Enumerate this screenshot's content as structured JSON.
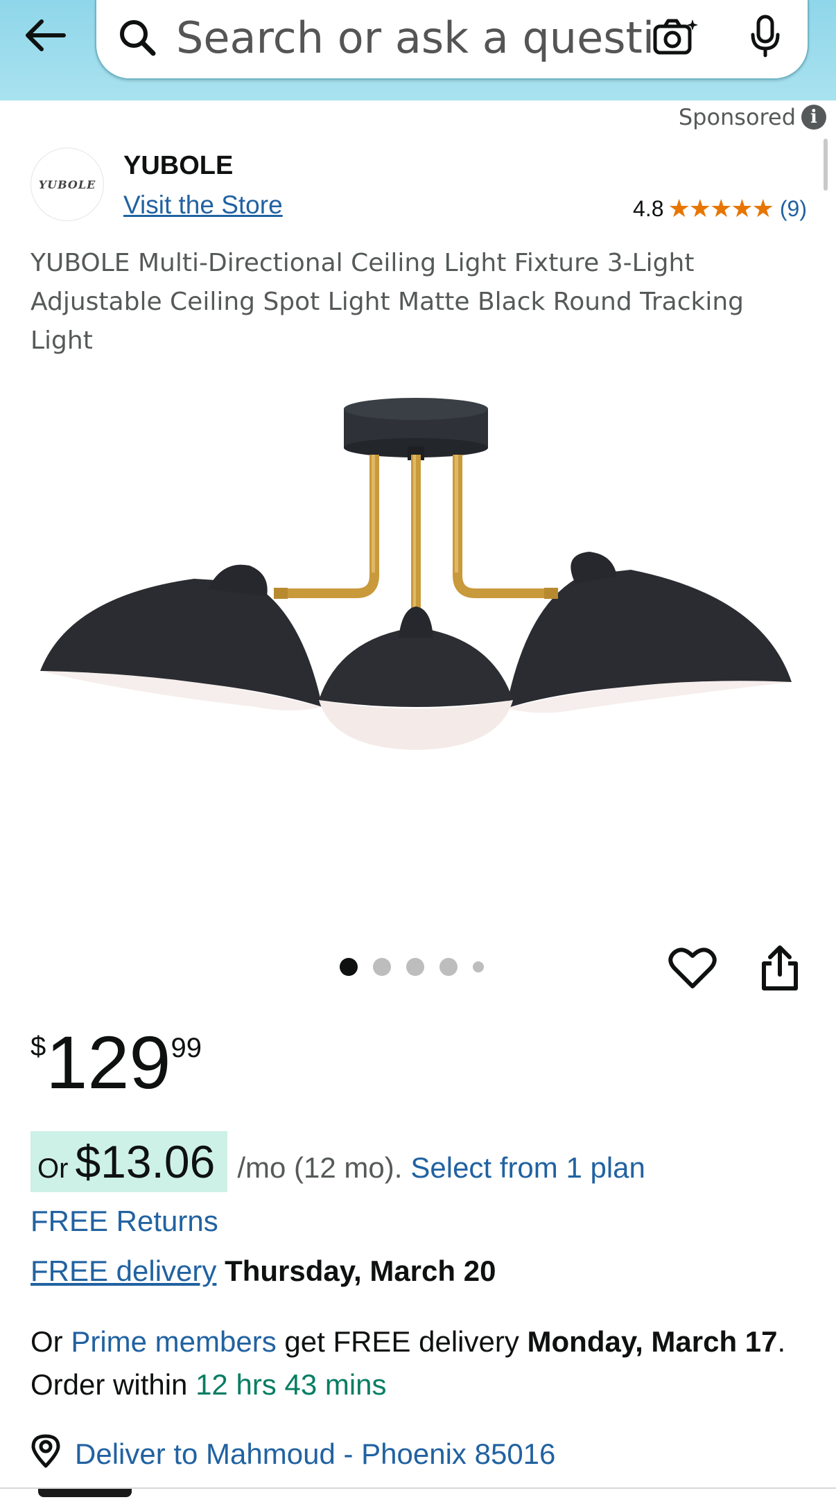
{
  "header": {
    "search": {
      "placeholder": "Search or ask a question"
    },
    "icons": {
      "back": "arrow-left-icon",
      "search": "search-icon",
      "camera": "camera-icon",
      "mic": "microphone-icon"
    }
  },
  "ad": {
    "sponsored_label": "Sponsored",
    "info_icon": "i"
  },
  "brand": {
    "logo_text": "YUBOLE",
    "name": "YUBOLE",
    "visit_store": "Visit the Store",
    "rating": "4.8",
    "stars": "★★★★★",
    "review_count": "(9)"
  },
  "product": {
    "title": "YUBOLE Multi-Directional Ceiling Light Fixture 3-Light Adjustable Ceiling Spot Light Matte Black Round Tracking Light",
    "image_count": 5,
    "active_image_index": 0
  },
  "price": {
    "symbol": "$",
    "whole": "129",
    "fraction": "99"
  },
  "installment": {
    "prefix": "Or",
    "amount": "$13.06",
    "terms": "/mo (12 mo).",
    "plan_link": "Select from 1 plan"
  },
  "shipping": {
    "free_returns": "FREE Returns",
    "free_delivery_link": "FREE delivery",
    "delivery_date": "Thursday, March 20",
    "prime_prefix": "Or",
    "prime_link": "Prime members",
    "prime_mid": "get FREE delivery",
    "prime_date": "Monday, March 17",
    "order_within_label": ". Order within",
    "countdown": "12 hrs 43 mins"
  },
  "location": {
    "deliver_to": "Deliver to Mahmoud - Phoenix 85016"
  },
  "colors": {
    "header_bg": "#a9e2ef",
    "link": "#2162a1",
    "star": "#e77600",
    "installment_highlight": "#cdf1e7",
    "countdown": "#067d62"
  }
}
